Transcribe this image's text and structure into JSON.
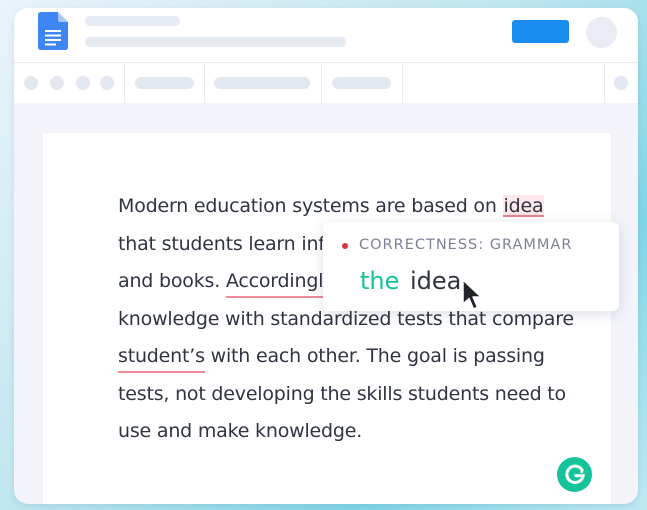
{
  "app": {
    "brand_icon": "google-docs-icon",
    "assistant_icon": "grammarly-g-icon",
    "accent_color": "#1a8cf0",
    "assistant_color": "#15c39a"
  },
  "document": {
    "lines": [
      "Modern education systems are based on ",
      "that students learn inf",
      "and books. ",
      "knowledge with standardized tests that compare",
      " with each other. The goal is passing",
      "tests, not developing the skills students need to",
      "use and make knowledge."
    ],
    "flagged_idea": "idea",
    "flagged_accordingly": "Accordingly",
    "flagged_students": "student’s"
  },
  "suggestion": {
    "category": "CORRECTNESS: GRAMMAR",
    "inserted_word": "the",
    "target_word": "idea",
    "category_color": "#e0313f"
  }
}
